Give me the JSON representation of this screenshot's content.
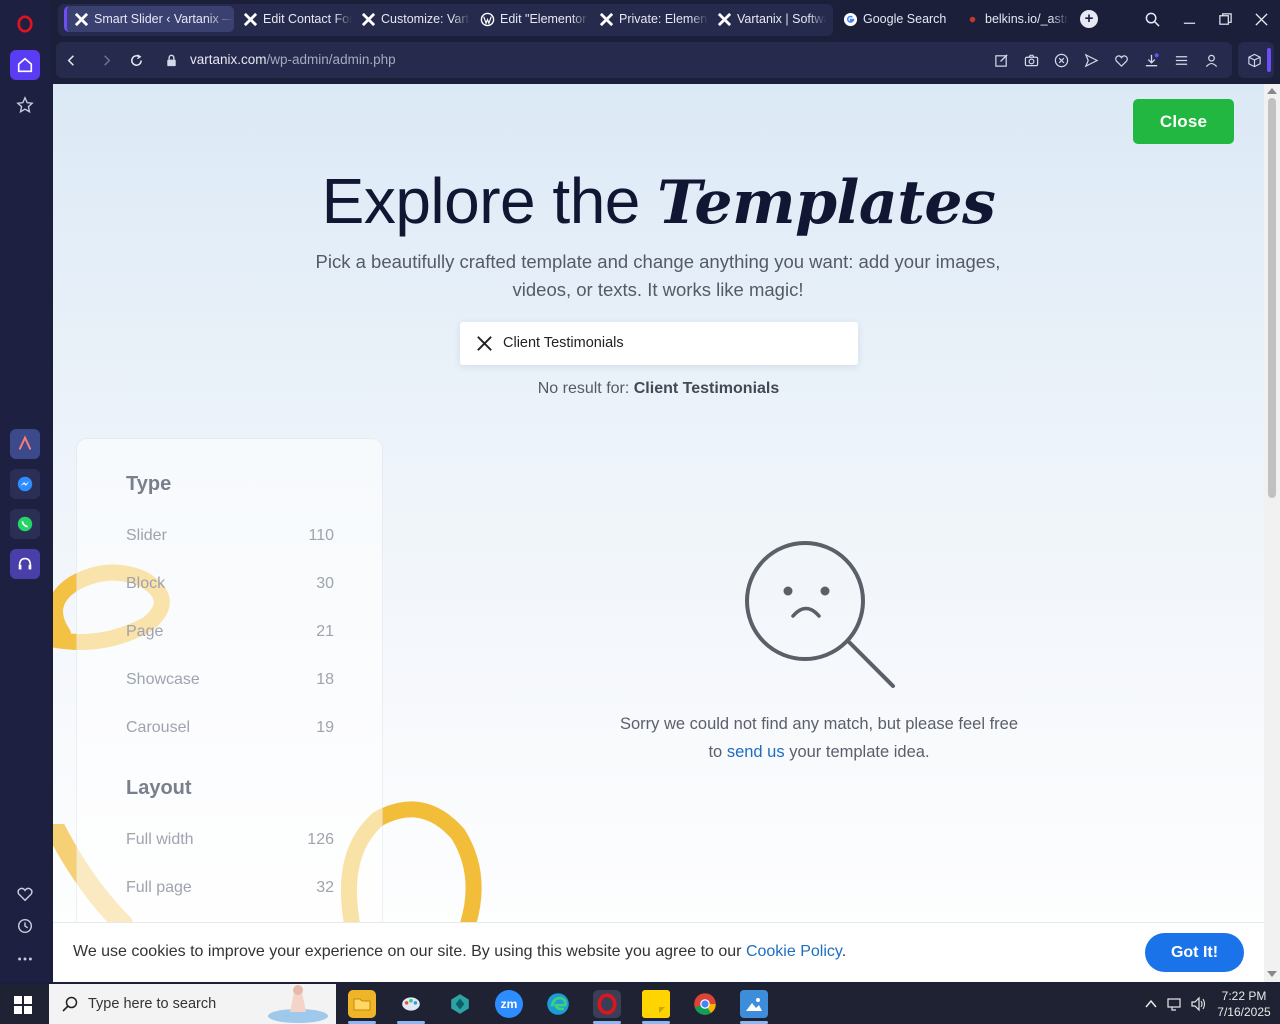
{
  "browser": {
    "tabs": [
      {
        "label": "Smart Slider ‹ Vartanix — W",
        "active": true,
        "favicon": "vartanix-x-icon"
      },
      {
        "label": "Edit Contact Form",
        "favicon": "vartanix-x-icon"
      },
      {
        "label": "Customize: Vartanix",
        "favicon": "vartanix-x-icon"
      },
      {
        "label": "Edit \"Elementor F",
        "favicon": "wordpress-icon"
      },
      {
        "label": "Private: Elementor",
        "favicon": "vartanix-x-icon"
      },
      {
        "label": "Vartanix | Software",
        "favicon": "vartanix-x-icon"
      },
      {
        "label": "Google Search",
        "favicon": "google-icon"
      },
      {
        "label": "belkins.io/_astro/",
        "favicon": "belkins-icon"
      }
    ],
    "url_host": "vartanix.com",
    "url_path": "/wp-admin/admin.php",
    "accent": "#6c4df7"
  },
  "modal": {
    "close_label": "Close",
    "headline_plain": "Explore the ",
    "headline_emph": "Templates",
    "subhead": "Pick a beautifully crafted template and change anything you want: add your images, videos, or texts. It works like magic!",
    "search_value": "Client Testimonials",
    "noresult_prefix": "No result for: ",
    "noresult_term": "Client Testimonials",
    "sorry_text_1": "Sorry we could not find any match, but please feel free to ",
    "sorry_link": "send us",
    "sorry_text_2": " your template idea.",
    "filters": {
      "type_heading": "Type",
      "type_items": [
        {
          "label": "Slider",
          "count": "110"
        },
        {
          "label": "Block",
          "count": "30"
        },
        {
          "label": "Page",
          "count": "21"
        },
        {
          "label": "Showcase",
          "count": "18"
        },
        {
          "label": "Carousel",
          "count": "19"
        }
      ],
      "layout_heading": "Layout",
      "layout_items": [
        {
          "label": "Full width",
          "count": "126"
        },
        {
          "label": "Full page",
          "count": "32"
        }
      ]
    },
    "close_color": "#22b740"
  },
  "cookie": {
    "text": "We use cookies to improve your experience on our site. By using this website you agree to our ",
    "link": "Cookie Policy",
    "suffix": ".",
    "button": "Got It!"
  },
  "taskbar": {
    "search_placeholder": "Type here to search",
    "time": "7:22 PM",
    "date": "7/16/2025",
    "apps": [
      "file-explorer-icon",
      "paint-icon",
      "app-icon",
      "zoom-icon",
      "edge-icon",
      "opera-icon",
      "sticky-notes-icon",
      "chrome-icon",
      "photos-icon"
    ]
  }
}
